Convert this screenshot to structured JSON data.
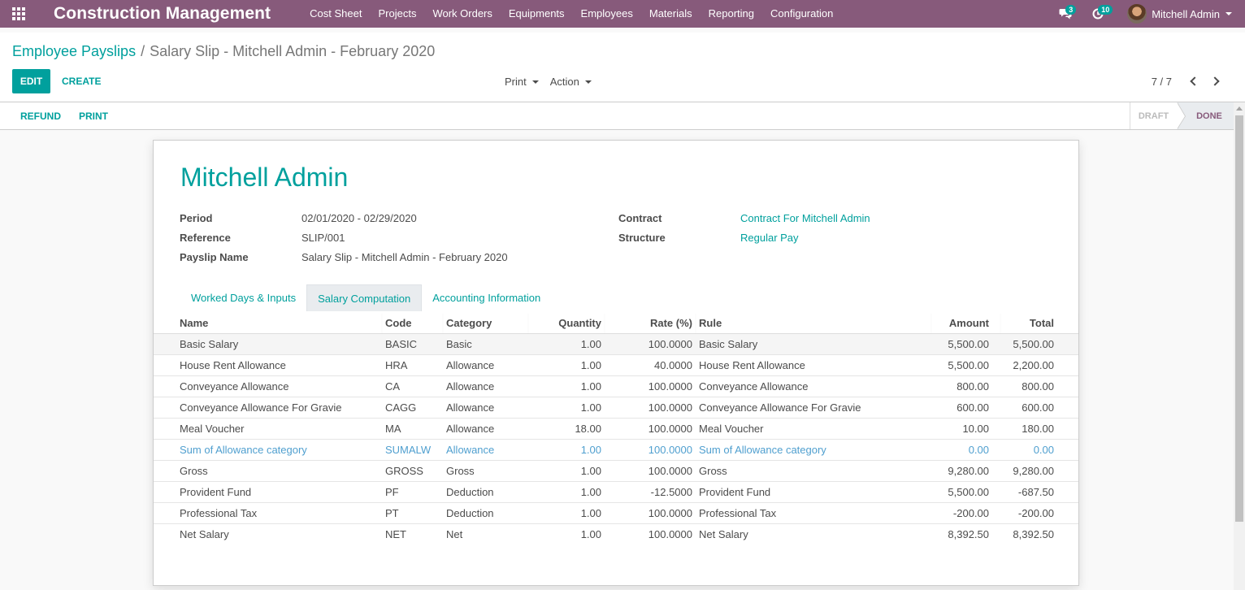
{
  "navbar": {
    "brand": "Construction Management",
    "menu": [
      "Cost Sheet",
      "Projects",
      "Work Orders",
      "Equipments",
      "Employees",
      "Materials",
      "Reporting",
      "Configuration"
    ],
    "messages_count": "3",
    "activities_count": "10",
    "user_name": "Mitchell Admin"
  },
  "breadcrumb": {
    "parent": "Employee Payslips",
    "separator": "/",
    "current": "Salary Slip - Mitchell Admin - February 2020"
  },
  "buttons": {
    "edit": "EDIT",
    "create": "CREATE",
    "print": "Print",
    "action": "Action",
    "refund": "REFUND",
    "print_slip": "PRINT"
  },
  "pager": {
    "value": "7 / 7"
  },
  "status": {
    "draft": "DRAFT",
    "done": "DONE",
    "current": "DONE"
  },
  "record": {
    "name": "Mitchell Admin",
    "fields_left": [
      {
        "label": "Period",
        "value": "02/01/2020 - 02/29/2020"
      },
      {
        "label": "Reference",
        "value": "SLIP/001"
      },
      {
        "label": "Payslip Name",
        "value": "Salary Slip - Mitchell Admin - February 2020"
      }
    ],
    "fields_right": [
      {
        "label": "Contract",
        "value": "Contract For Mitchell Admin"
      },
      {
        "label": "Structure",
        "value": "Regular Pay"
      }
    ]
  },
  "tabs": [
    {
      "label": "Worked Days & Inputs",
      "active": false
    },
    {
      "label": "Salary Computation",
      "active": true
    },
    {
      "label": "Accounting Information",
      "active": false
    }
  ],
  "lines": {
    "columns": [
      "Name",
      "Code",
      "Category",
      "Quantity",
      "Rate (%)",
      "Rule",
      "Amount",
      "Total"
    ],
    "rows": [
      [
        "Basic Salary",
        "BASIC",
        "Basic",
        "1.00",
        "100.0000",
        "Basic Salary",
        "5,500.00",
        "5,500.00"
      ],
      [
        "House Rent Allowance",
        "HRA",
        "Allowance",
        "1.00",
        "40.0000",
        "House Rent Allowance",
        "5,500.00",
        "2,200.00"
      ],
      [
        "Conveyance Allowance",
        "CA",
        "Allowance",
        "1.00",
        "100.0000",
        "Conveyance Allowance",
        "800.00",
        "800.00"
      ],
      [
        "Conveyance Allowance For Gravie",
        "CAGG",
        "Allowance",
        "1.00",
        "100.0000",
        "Conveyance Allowance For Gravie",
        "600.00",
        "600.00"
      ],
      [
        "Meal Voucher",
        "MA",
        "Allowance",
        "18.00",
        "100.0000",
        "Meal Voucher",
        "10.00",
        "180.00"
      ],
      [
        "Sum of Allowance category",
        "SUMALW",
        "Allowance",
        "1.00",
        "100.0000",
        "Sum of Allowance category",
        "0.00",
        "0.00"
      ],
      [
        "Gross",
        "GROSS",
        "Gross",
        "1.00",
        "100.0000",
        "Gross",
        "9,280.00",
        "9,280.00"
      ],
      [
        "Provident Fund",
        "PF",
        "Deduction",
        "1.00",
        "-12.5000",
        "Provident Fund",
        "5,500.00",
        "-687.50"
      ],
      [
        "Professional Tax",
        "PT",
        "Deduction",
        "1.00",
        "100.0000",
        "Professional Tax",
        "-200.00",
        "-200.00"
      ],
      [
        "Net Salary",
        "NET",
        "Net",
        "1.00",
        "100.0000",
        "Net Salary",
        "8,392.50",
        "8,392.50"
      ]
    ]
  },
  "colors": {
    "navbar": "#875a7b",
    "accent": "#00a09d",
    "muted_row": "#4f9fcf"
  }
}
